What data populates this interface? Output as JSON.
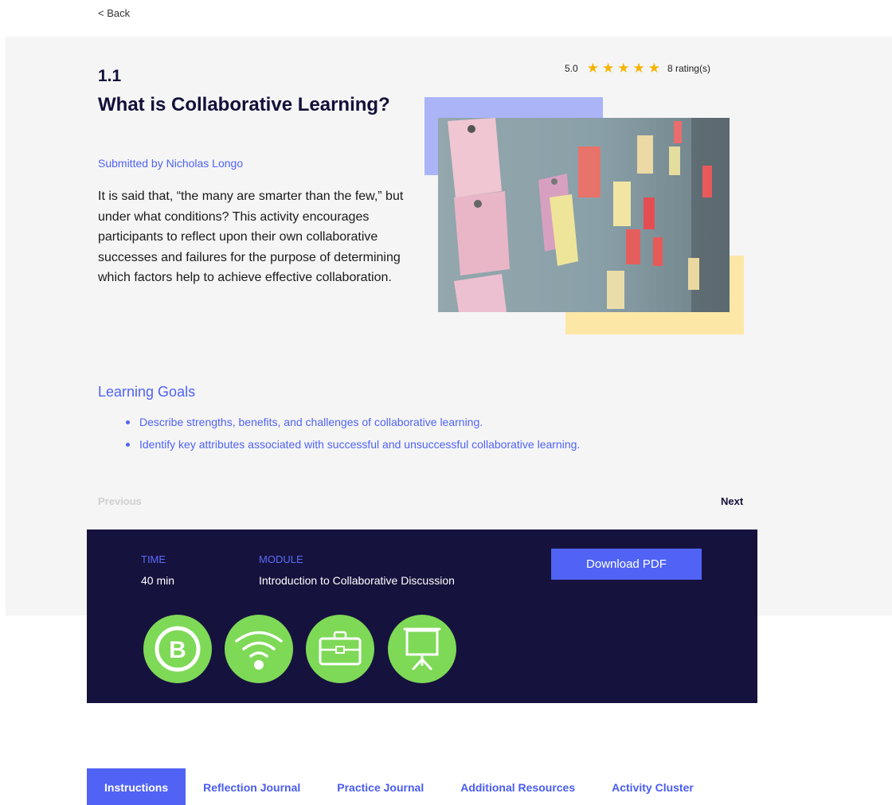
{
  "nav": {
    "back_label": "< Back"
  },
  "activity": {
    "number": "1.1",
    "title": "What is Collaborative Learning?",
    "submitted_by": "Submitted by Nicholas Longo",
    "description": "It is said that, “the many are smarter than the few,” but under what conditions? This activity encourages participants to reflect upon their own collaborative successes and failures for the purpose of determining which factors help to achieve effective collaboration."
  },
  "rating": {
    "score": "5.0",
    "stars": 5,
    "star_glyph": "★",
    "count_label": "8 rating(s)"
  },
  "learning_goals": {
    "heading": "Learning Goals",
    "items": [
      "Describe strengths, benefits, and challenges of collaborative learning.",
      "Identify key attributes associated with successful and unsuccessful collaborative learning."
    ]
  },
  "pagination": {
    "previous_label": "Previous",
    "next_label": "Next"
  },
  "details": {
    "time_label": "TIME",
    "time_value": "40 min",
    "module_label": "MODULE",
    "module_value": "Introduction to Collaborative Discussion",
    "download_label": "Download PDF",
    "icons": [
      "b-letter-icon",
      "wifi-icon",
      "briefcase-icon",
      "presentation-icon"
    ]
  },
  "tabs": [
    {
      "label": "Instructions",
      "active": true
    },
    {
      "label": "Reflection Journal",
      "active": false
    },
    {
      "label": "Practice Journal",
      "active": false
    },
    {
      "label": "Additional Resources",
      "active": false
    },
    {
      "label": "Activity Cluster",
      "active": false
    }
  ],
  "colors": {
    "accent": "#5063f5",
    "dark_panel": "#16123e",
    "badge_green": "#7ed957",
    "star": "#f5b400",
    "deco_blue": "#aab4f7",
    "deco_yellow": "#fde7a6",
    "hero_bg": "#f5f5f5"
  }
}
